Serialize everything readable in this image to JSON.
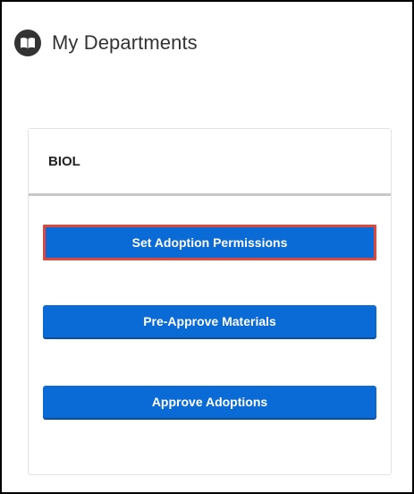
{
  "page": {
    "title": "My Departments",
    "title_icon": "book-icon"
  },
  "department": {
    "code": "BIOL",
    "actions": [
      {
        "label": "Set Adoption Permissions",
        "highlighted": true
      },
      {
        "label": "Pre-Approve Materials",
        "highlighted": false
      },
      {
        "label": "Approve Adoptions",
        "highlighted": false
      }
    ]
  },
  "colors": {
    "button": "#0a6ad6",
    "highlight_outline": "#e0473c",
    "title_text": "#333333"
  }
}
